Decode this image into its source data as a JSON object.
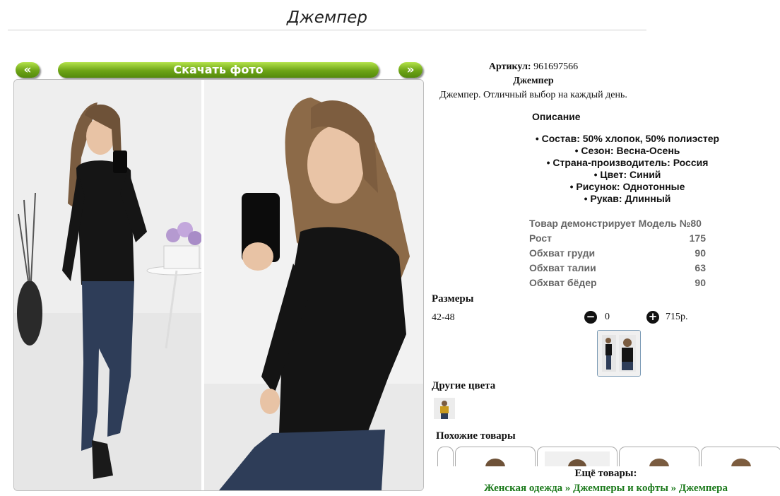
{
  "page": {
    "title": "Джемпер"
  },
  "gallery": {
    "prev_label": "«",
    "download_label": "Скачать фото",
    "next_label": "»"
  },
  "product": {
    "sku_label": "Артикул:",
    "sku_value": "961697566",
    "name": "Джемпер",
    "tagline": "Джемпер. Отличный выбор на каждый день."
  },
  "description": {
    "heading": "Описание",
    "items": [
      "• Состав: 50% хлопок, 50% полиэстер",
      "• Сезон: Весна-Осень",
      "• Страна-производитель: Россия",
      "• Цвет: Синий",
      "• Рисунок: Однотонные",
      "• Рукав: Длинный"
    ]
  },
  "model": {
    "heading": "Товар демонстрирует Модель №80",
    "rows": [
      {
        "label": "Рост",
        "value": "175"
      },
      {
        "label": "Обхват груди",
        "value": "90"
      },
      {
        "label": "Обхват талии",
        "value": "63"
      },
      {
        "label": "Обхват бёдер",
        "value": "90"
      }
    ]
  },
  "sizes": {
    "heading": "Размеры",
    "range": "42-48",
    "quantity": "0",
    "minus_symbol": "−",
    "plus_symbol": "+",
    "price": "715р."
  },
  "other_colors": {
    "heading": "Другие цвета"
  },
  "similar": {
    "heading": "Похожие товары"
  },
  "more_products": {
    "label": "Ещё товары:",
    "breadcrumb": [
      "Женская одежда",
      "Джемперы и кофты",
      "Джемпера"
    ],
    "separator": "»"
  },
  "colors": {
    "button_green": "#6ca316",
    "link_green": "#1c7a1c",
    "sweater": "#141414",
    "jeans": "#2e3d58",
    "mustard": "#c99a1e"
  }
}
